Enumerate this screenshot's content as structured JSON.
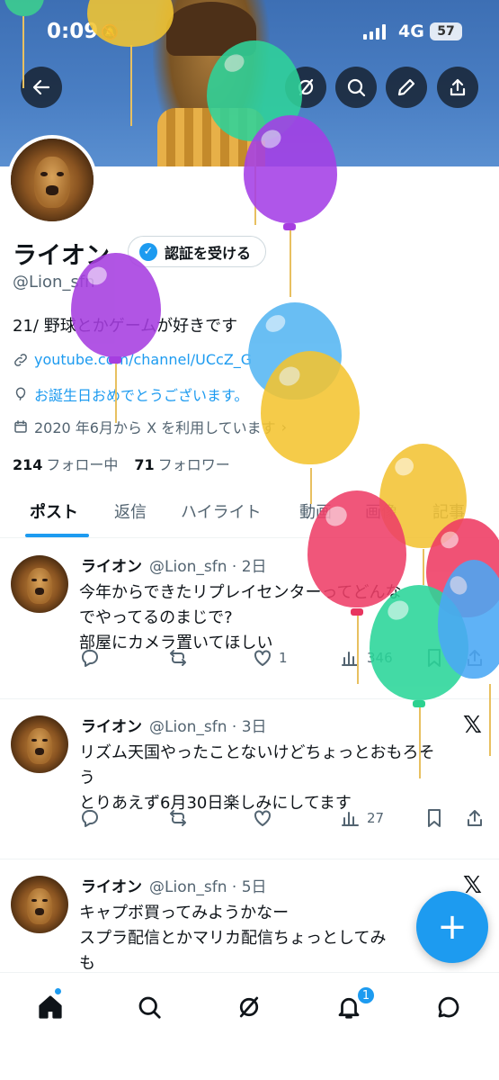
{
  "status_bar": {
    "time": "0:09",
    "network": "4G",
    "battery": "57"
  },
  "profile": {
    "name": "ライオン",
    "verify_button": "認証を受ける",
    "handle": "@Lion_sfn",
    "bio": "21/ 野球とかゲームが好きです",
    "link": "youtube.com/channel/UCcZ_G",
    "birthday": "お誕生日おめでとうございます。",
    "joined": "2020 年6月から X を利用しています",
    "following_count": "214",
    "following_label": "フォロー中",
    "followers_count": "71",
    "followers_label": "フォロワー"
  },
  "tabs": [
    "ポスト",
    "返信",
    "ハイライト",
    "動画",
    "画像",
    "記事"
  ],
  "posts": [
    {
      "name": "ライオン",
      "meta": "@Lion_sfn · 2日",
      "lines": [
        "今年からできたリプレイセンターってどんな",
        "でやってるのまじで?",
        "部屋にカメラ置いてほしい"
      ],
      "likes": "1",
      "views": "346"
    },
    {
      "name": "ライオン",
      "meta": "@Lion_sfn · 3日",
      "lines": [
        "リズム天国やったことないけどちょっとおもろそ",
        "う",
        "とりあえず6月30日楽しみにしてます"
      ],
      "likes": "",
      "views": "27"
    },
    {
      "name": "ライオン",
      "meta": "@Lion_sfn · 5日",
      "lines": [
        "キャプボ買ってみようかなー",
        "スプラ配信とかマリカ配信ちょっとしてみ",
        "も"
      ],
      "likes": "",
      "views": ""
    }
  ],
  "x_logo": "𝕏",
  "fab": "+",
  "notifications_badge": "1",
  "colors": {
    "accent": "#1d9bf0",
    "text": "#0f1419",
    "secondary": "#536471"
  }
}
